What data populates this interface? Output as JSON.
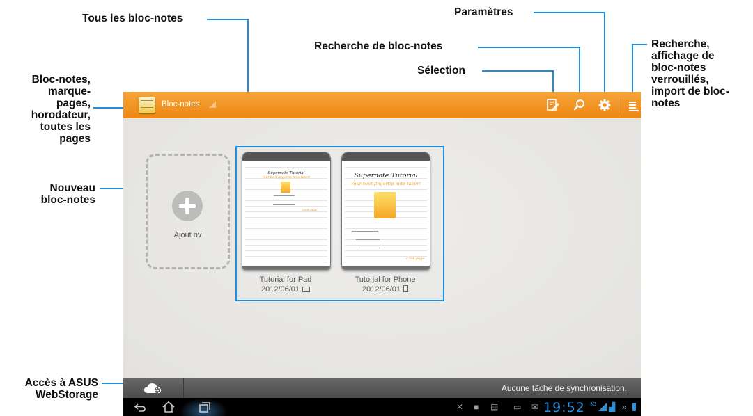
{
  "callouts": {
    "all_notebooks": "Tous les bloc-notes",
    "settings": "Paramètres",
    "notebook_search": "Recherche de bloc-notes",
    "selection": "Sélection",
    "menu_lines": [
      "Recherche,",
      "affichage de",
      "bloc-notes",
      "verrouillés,",
      "import de bloc-",
      "notes"
    ],
    "notebook_bookmarks_lines": [
      "Bloc-notes,",
      "marque-",
      "pages,",
      "horodateur,",
      "toutes les",
      "pages"
    ],
    "new_notebook_lines": [
      "Nouveau",
      "bloc-notes"
    ],
    "webstorage_lines": [
      "Accès à ASUS",
      "WebStorage"
    ]
  },
  "app": {
    "title": "Bloc-notes",
    "accent_color": "#f0901e",
    "highlight_color": "#1f8fd6",
    "icons": [
      "selection-icon",
      "search-icon",
      "gear-icon",
      "menu-icon"
    ]
  },
  "new_notebook": {
    "label": "Ajout nv"
  },
  "notebooks": [
    {
      "title": "Tutorial for Pad",
      "date": "2012/06/01",
      "device_icon": "tablet-icon",
      "cover_title": "Supernote Tutorial",
      "cover_subtitle": "Your best fingertip note taker!",
      "signature": "Look page"
    },
    {
      "title": "Tutorial for Phone",
      "date": "2012/06/01",
      "device_icon": "phone-icon",
      "cover_title": "Supernote Tutorial",
      "cover_subtitle": "Your best fingertip note taker!",
      "signature": "Look page"
    }
  ],
  "status": {
    "sync_text": "Aucune tâche de synchronisation.",
    "time": "19:52",
    "network": "3G"
  }
}
